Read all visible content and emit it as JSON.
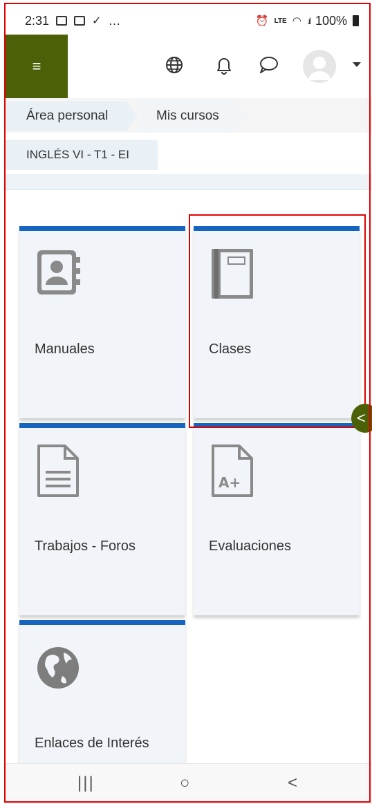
{
  "status_bar": {
    "time": "2:31",
    "overflow": "…",
    "battery": "100%",
    "icons": [
      "gallery-icon",
      "email-icon",
      "download-done-icon",
      "alarm-icon",
      "volte-icon",
      "wifi-icon",
      "signal-icon",
      "battery-icon"
    ]
  },
  "navbar": {
    "menu_icon": "≡",
    "icons": [
      "globe-icon",
      "bell-icon",
      "chat-icon",
      "avatar",
      "caret-down-icon"
    ]
  },
  "breadcrumb": {
    "items": [
      "Área personal",
      "Mis cursos"
    ]
  },
  "course": {
    "name": "INGLÉS VI - T1 - EI"
  },
  "tiles": [
    {
      "label": "Manuales",
      "icon": "contact-book-icon"
    },
    {
      "label": "Clases",
      "icon": "notebook-icon"
    },
    {
      "label": "Trabajos - Foros",
      "icon": "document-icon"
    },
    {
      "label": "Evaluaciones",
      "icon": "grade-document-icon"
    },
    {
      "label": "Enlaces de Interés",
      "icon": "globe-americas-icon"
    }
  ],
  "colors": {
    "brand": "#4c6107",
    "tile_accent": "#1565c0",
    "tile_bg": "#f1f4f8",
    "highlight": "#e00000"
  },
  "drawer_tab": {
    "glyph": "<"
  },
  "bottom_nav": {
    "recents": "|||",
    "home": "○",
    "back": "<"
  }
}
